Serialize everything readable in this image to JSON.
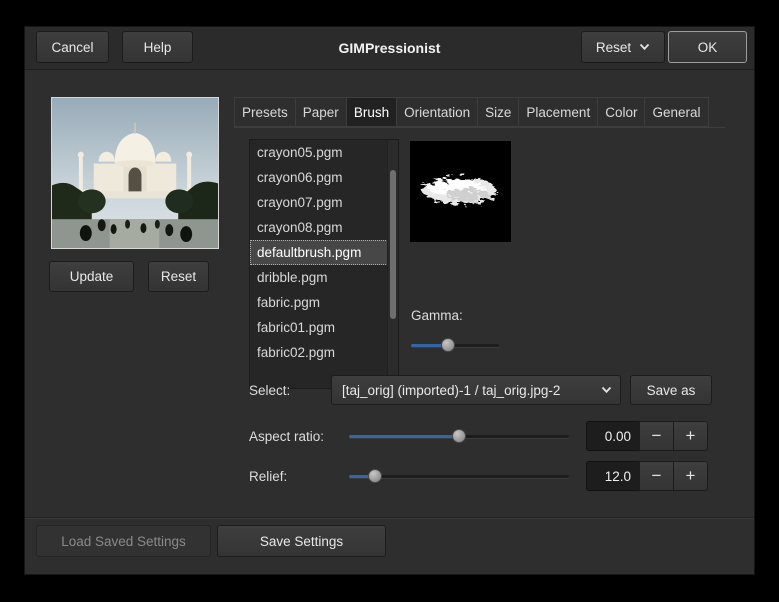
{
  "titlebar": {
    "cancel_label": "Cancel",
    "help_label": "Help",
    "title": "GIMPressionist",
    "reset_label": "Reset",
    "ok_label": "OK"
  },
  "preview_panel": {
    "update_label": "Update",
    "reset_label": "Reset"
  },
  "tabs": [
    "Presets",
    "Paper",
    "Brush",
    "Orientation",
    "Size",
    "Placement",
    "Color",
    "General"
  ],
  "active_tab": "Brush",
  "brush_tab": {
    "files": [
      "crayon05.pgm",
      "crayon06.pgm",
      "crayon07.pgm",
      "crayon08.pgm",
      "defaultbrush.pgm",
      "dribble.pgm",
      "fabric.pgm",
      "fabric01.pgm",
      "fabric02.pgm"
    ],
    "selected_file": "defaultbrush.pgm",
    "gamma_label": "Gamma:",
    "select_label": "Select:",
    "select_value": "[taj_orig] (imported)-1 / taj_orig.jpg-2",
    "save_as_label": "Save as",
    "aspect_ratio_label": "Aspect ratio:",
    "aspect_ratio_value": "0.00",
    "relief_label": "Relief:",
    "relief_value": "12.0"
  },
  "footer": {
    "load_saved_label": "Load Saved Settings",
    "save_settings_label": "Save Settings"
  },
  "icons": {
    "minus": "−",
    "plus": "+"
  },
  "colors": {
    "accent_blue": "#3465a4",
    "dialog_bg": "#2e2e2e",
    "window_frame": "#000000"
  }
}
